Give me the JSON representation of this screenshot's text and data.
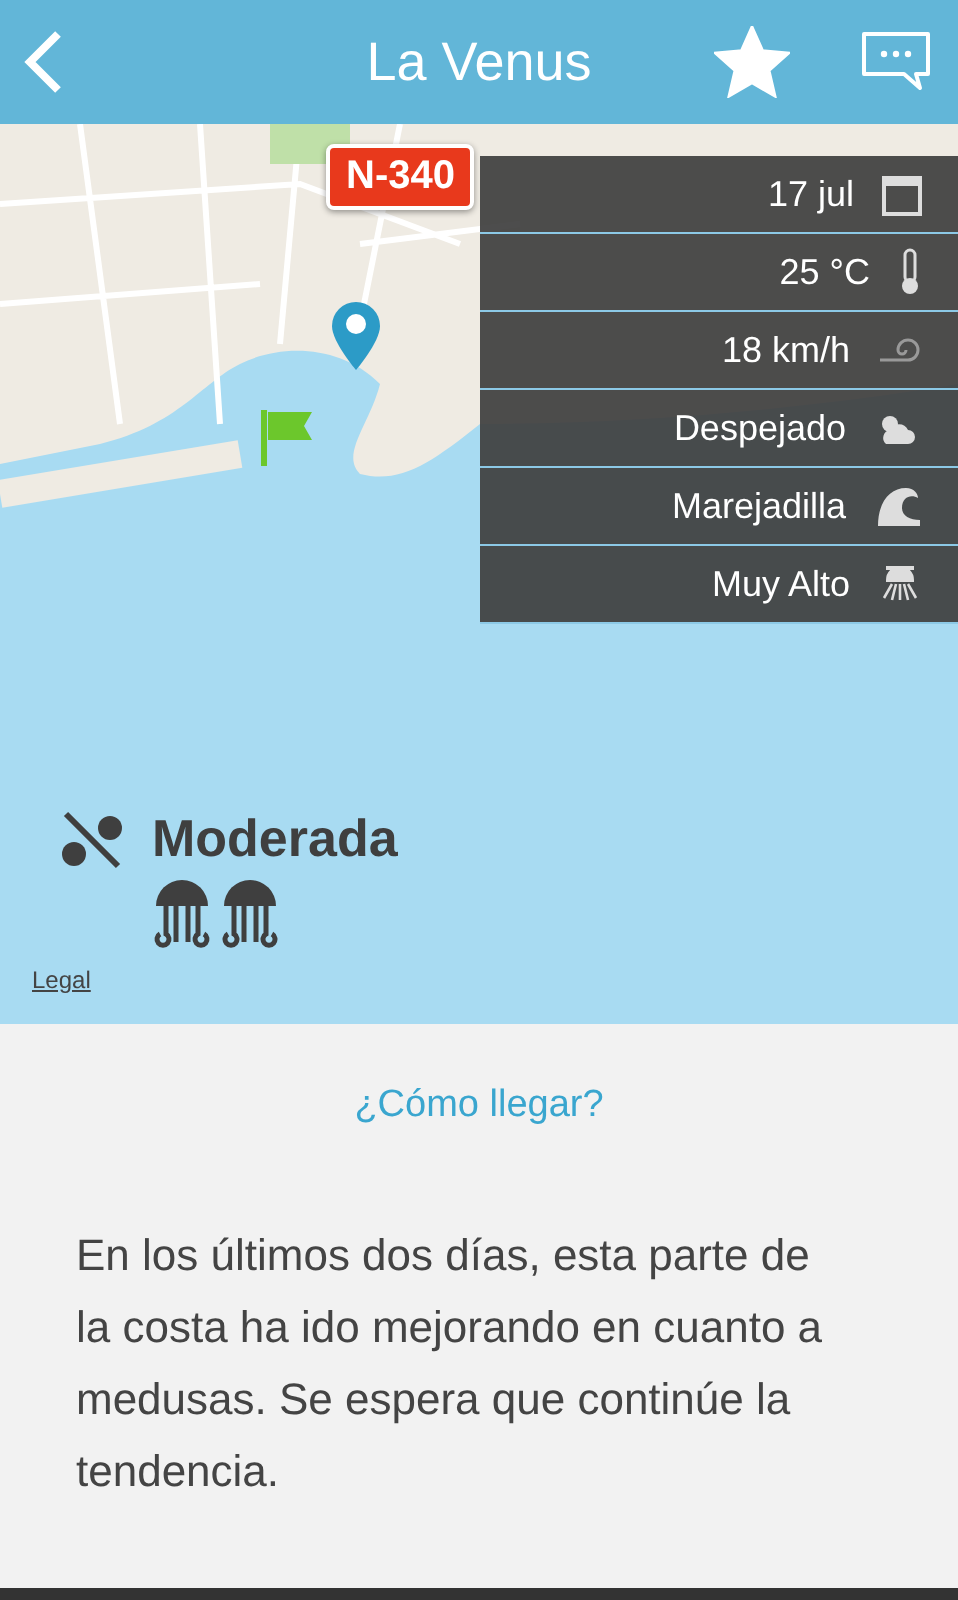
{
  "header": {
    "title": "La Venus",
    "favorite": true
  },
  "map": {
    "road_badge": "N-340",
    "conditions": [
      {
        "kind": "date",
        "text": "17 jul"
      },
      {
        "kind": "temperature",
        "text": "25 °C"
      },
      {
        "kind": "wind",
        "text": "18 km/h"
      },
      {
        "kind": "sky",
        "text": "Despejado"
      },
      {
        "kind": "waves",
        "text": "Marejadilla"
      },
      {
        "kind": "uv",
        "text": "Muy Alto"
      }
    ],
    "jellyfish": {
      "label": "Moderada",
      "icons": [
        {
          "kind": "jellyfish"
        },
        {
          "kind": "jellyfish"
        }
      ]
    },
    "legal": "Legal"
  },
  "directions_link": "¿Cómo llegar?",
  "description": "En los últimos dos días, esta parte de la costa ha ido mejorando en cuanto a medusas. Se espera que continúe la tendencia."
}
